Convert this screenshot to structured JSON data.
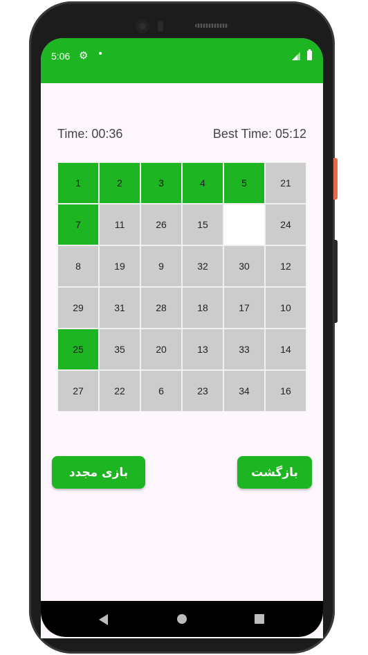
{
  "status_bar": {
    "time": "5:06",
    "gear_icon": "⚙",
    "dot": "•",
    "background": "#1db522"
  },
  "game": {
    "time_label": "Time: 00:36",
    "best_time_label": "Best Time: 05:12",
    "board": {
      "columns": 6,
      "rows": 6,
      "tiles": [
        {
          "value": "1",
          "state": "correct"
        },
        {
          "value": "2",
          "state": "correct"
        },
        {
          "value": "3",
          "state": "correct"
        },
        {
          "value": "4",
          "state": "correct"
        },
        {
          "value": "5",
          "state": "correct"
        },
        {
          "value": "21",
          "state": "normal"
        },
        {
          "value": "7",
          "state": "correct"
        },
        {
          "value": "11",
          "state": "normal"
        },
        {
          "value": "26",
          "state": "normal"
        },
        {
          "value": "15",
          "state": "normal"
        },
        {
          "value": "",
          "state": "empty"
        },
        {
          "value": "24",
          "state": "normal"
        },
        {
          "value": "8",
          "state": "normal"
        },
        {
          "value": "19",
          "state": "normal"
        },
        {
          "value": "9",
          "state": "normal"
        },
        {
          "value": "32",
          "state": "normal"
        },
        {
          "value": "30",
          "state": "normal"
        },
        {
          "value": "12",
          "state": "normal"
        },
        {
          "value": "29",
          "state": "normal"
        },
        {
          "value": "31",
          "state": "normal"
        },
        {
          "value": "28",
          "state": "normal"
        },
        {
          "value": "18",
          "state": "normal"
        },
        {
          "value": "17",
          "state": "normal"
        },
        {
          "value": "10",
          "state": "normal"
        },
        {
          "value": "25",
          "state": "correct"
        },
        {
          "value": "35",
          "state": "normal"
        },
        {
          "value": "20",
          "state": "normal"
        },
        {
          "value": "13",
          "state": "normal"
        },
        {
          "value": "33",
          "state": "normal"
        },
        {
          "value": "14",
          "state": "normal"
        },
        {
          "value": "27",
          "state": "normal"
        },
        {
          "value": "22",
          "state": "normal"
        },
        {
          "value": "6",
          "state": "normal"
        },
        {
          "value": "23",
          "state": "normal"
        },
        {
          "value": "34",
          "state": "normal"
        },
        {
          "value": "16",
          "state": "normal"
        }
      ]
    }
  },
  "buttons": {
    "restart_label": "بازی مجدد",
    "back_label": "بازگشت"
  },
  "colors": {
    "accent": "#1db522",
    "tile": "#cccccc",
    "empty_tile": "#ffffff",
    "screen_bg": "#fdf6fd"
  }
}
